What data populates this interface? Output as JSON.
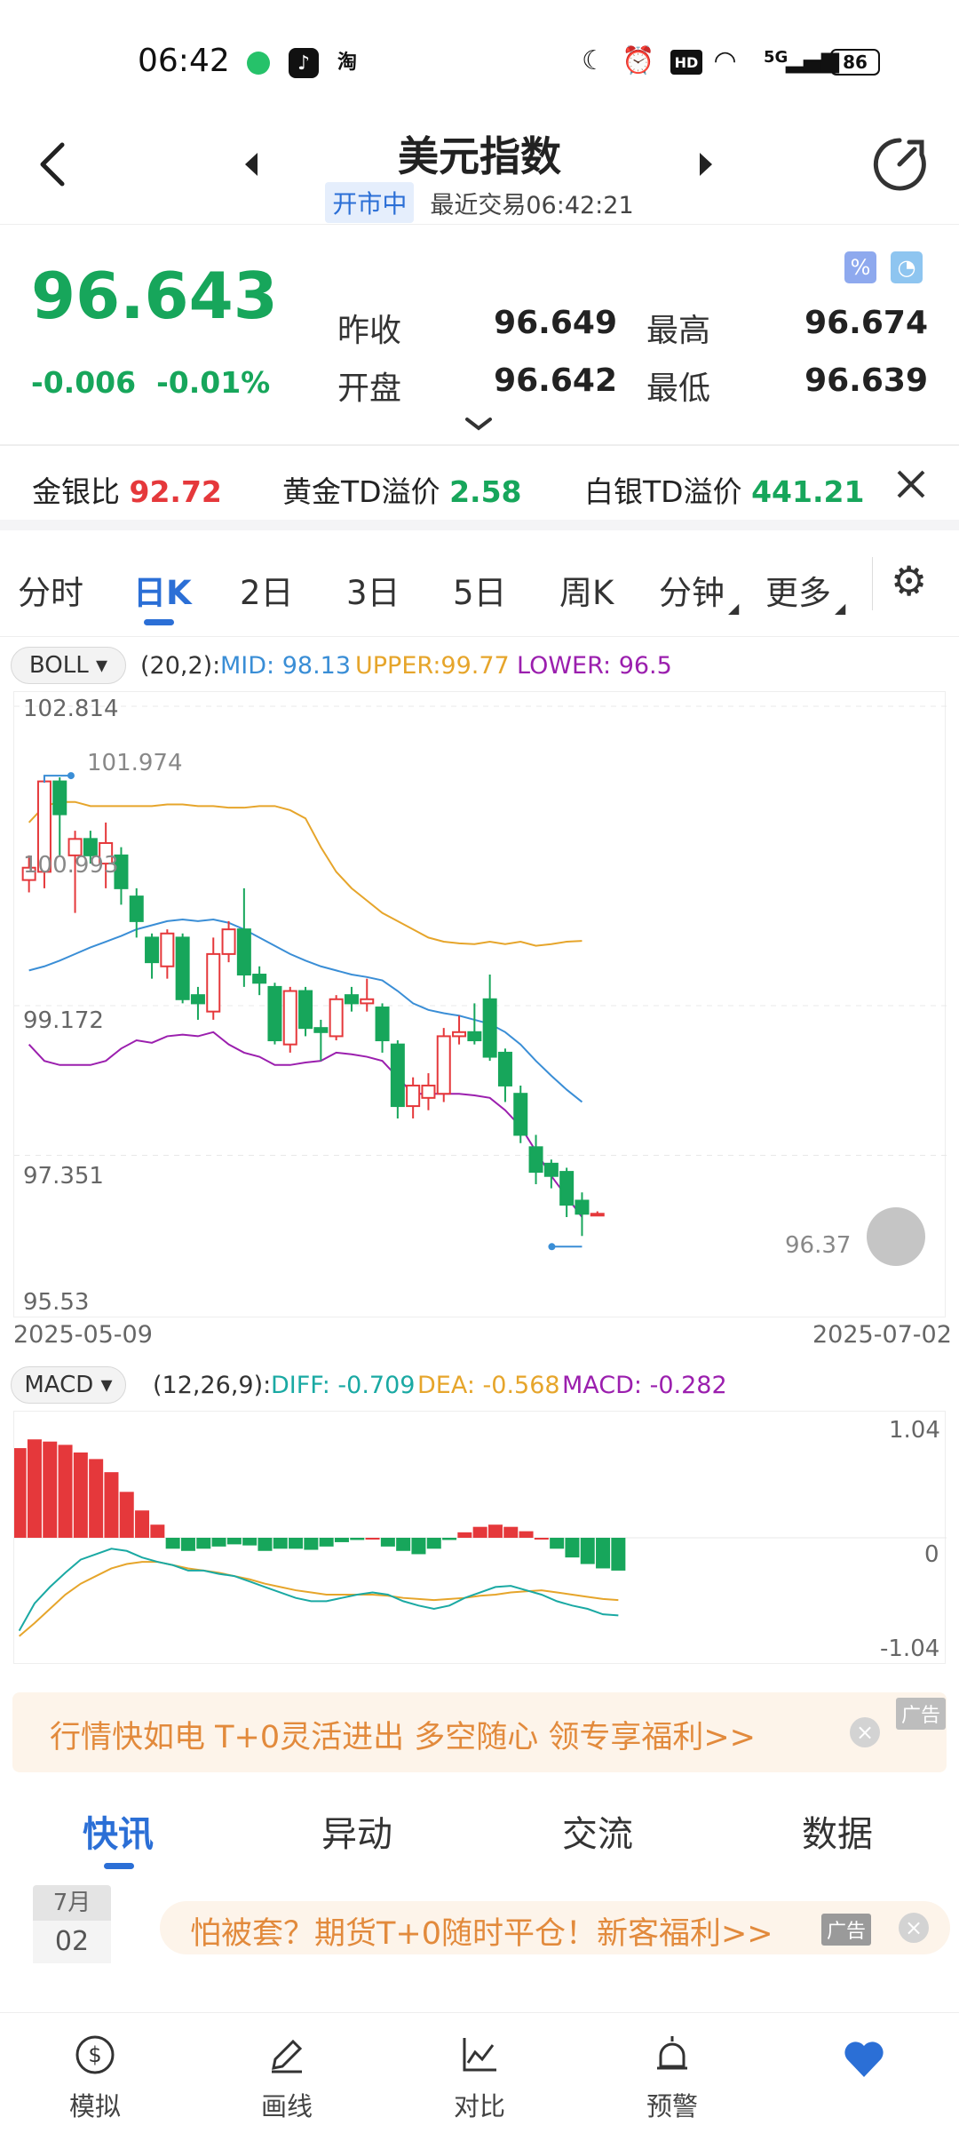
{
  "status_bar": {
    "time": "06:42",
    "battery": "86",
    "network": "5G",
    "hd": "HD"
  },
  "header": {
    "title": "美元指数",
    "market_status": "开市中",
    "last_trade": "最近交易06:42:21"
  },
  "quote": {
    "price": "96.643",
    "change": "-0.006",
    "change_pct": "-0.01%",
    "prev_close_label": "昨收",
    "prev_close": "96.649",
    "high_label": "最高",
    "high": "96.674",
    "open_label": "开盘",
    "open": "96.642",
    "low_label": "最低",
    "low": "96.639"
  },
  "ticker": [
    {
      "label": "金银比",
      "value": "92.72",
      "color": "#e5383b"
    },
    {
      "label": "黄金TD溢价",
      "value": "2.58",
      "color": "#17a65b"
    },
    {
      "label": "白银TD溢价",
      "value": "441.21",
      "color": "#17a65b"
    }
  ],
  "period_tabs": [
    "分时",
    "日K",
    "2日",
    "3日",
    "5日",
    "周K",
    "分钟",
    "更多"
  ],
  "active_tab": "日K",
  "boll": {
    "name": "BOLL",
    "params": "(20,2):",
    "mid": "MID: 98.13",
    "upper": "UPPER:99.77",
    "lower": "LOWER: 96.5"
  },
  "price_axis": {
    "top": "102.814",
    "mid1": "99.172",
    "mid2": "97.351",
    "bottom": "95.53",
    "max_label": "101.974",
    "left_label": "100.993",
    "min_label": "96.37"
  },
  "date_range": {
    "start": "2025-05-09",
    "end": "2025-07-02"
  },
  "macd": {
    "name": "MACD",
    "params": "(12,26,9):",
    "diff": "DIFF: -0.709",
    "dea": "DEA: -0.568",
    "macd": "MACD: -0.282",
    "axis_top": "1.04",
    "axis_mid": "0",
    "axis_bottom": "-1.04"
  },
  "colors": {
    "up": "#e5383b",
    "down": "#17a65b",
    "mid": "#3a8ed6",
    "upper": "#e6a52b",
    "lower": "#9b1fae",
    "accent": "#2b6fd6"
  },
  "chart_data": [
    {
      "type": "candlestick",
      "ylim": [
        95.53,
        102.814
      ],
      "candles": [
        [
          100.7,
          100.85,
          101.0,
          100.55
        ],
        [
          100.8,
          101.9,
          101.97,
          100.6
        ],
        [
          101.9,
          101.5,
          101.95,
          101.0
        ],
        [
          101.0,
          101.2,
          101.3,
          100.3
        ],
        [
          101.2,
          101.0,
          101.3,
          100.9
        ],
        [
          100.9,
          101.15,
          101.4,
          100.6
        ],
        [
          101.0,
          100.6,
          101.1,
          100.4
        ],
        [
          100.5,
          100.2,
          100.6,
          100.0
        ],
        [
          100.0,
          99.7,
          100.05,
          99.5
        ],
        [
          99.65,
          100.05,
          100.1,
          99.5
        ],
        [
          100.0,
          99.25,
          100.05,
          99.2
        ],
        [
          99.3,
          99.2,
          99.4,
          99.0
        ],
        [
          99.1,
          99.8,
          100.0,
          99.0
        ],
        [
          99.8,
          100.1,
          100.2,
          99.7
        ],
        [
          100.1,
          99.55,
          100.6,
          99.4
        ],
        [
          99.55,
          99.45,
          99.65,
          99.3
        ],
        [
          99.4,
          98.75,
          99.45,
          98.7
        ],
        [
          98.7,
          99.35,
          99.4,
          98.6
        ],
        [
          99.35,
          98.9,
          99.4,
          98.8
        ],
        [
          98.9,
          98.85,
          99.0,
          98.5
        ],
        [
          98.8,
          99.25,
          99.3,
          98.75
        ],
        [
          99.3,
          99.2,
          99.4,
          99.1
        ],
        [
          99.2,
          99.25,
          99.5,
          99.1
        ],
        [
          99.15,
          98.75,
          99.2,
          98.6
        ],
        [
          98.7,
          97.95,
          98.75,
          97.8
        ],
        [
          97.95,
          98.2,
          98.3,
          97.8
        ],
        [
          98.05,
          98.2,
          98.35,
          97.9
        ],
        [
          98.1,
          98.8,
          98.9,
          98.0
        ],
        [
          98.8,
          98.85,
          99.05,
          98.7
        ],
        [
          98.85,
          98.75,
          99.2,
          98.7
        ],
        [
          99.25,
          98.55,
          99.55,
          98.5
        ],
        [
          98.6,
          98.2,
          98.65,
          98.0
        ],
        [
          98.1,
          97.6,
          98.2,
          97.5
        ],
        [
          97.45,
          97.15,
          97.6,
          97.0
        ],
        [
          97.25,
          97.1,
          97.3,
          96.95
        ],
        [
          97.15,
          96.75,
          97.2,
          96.6
        ],
        [
          96.8,
          96.64,
          96.9,
          96.37
        ],
        [
          96.64,
          96.64,
          96.67,
          96.64
        ]
      ],
      "mid": [
        99.6,
        99.65,
        99.72,
        99.8,
        99.88,
        99.95,
        100.02,
        100.1,
        100.15,
        100.2,
        100.22,
        100.2,
        100.22,
        100.18,
        100.1,
        100.0,
        99.9,
        99.8,
        99.72,
        99.65,
        99.6,
        99.55,
        99.52,
        99.48,
        99.35,
        99.2,
        99.12,
        99.08,
        99.05,
        99.0,
        98.95,
        98.85,
        98.7,
        98.5,
        98.32,
        98.15,
        98.0
      ],
      "upper": [
        101.4,
        101.6,
        101.65,
        101.65,
        101.6,
        101.6,
        101.6,
        101.6,
        101.6,
        101.62,
        101.62,
        101.6,
        101.6,
        101.58,
        101.58,
        101.6,
        101.6,
        101.55,
        101.45,
        101.1,
        100.8,
        100.6,
        100.45,
        100.3,
        100.2,
        100.1,
        100.0,
        99.95,
        99.93,
        99.92,
        99.95,
        99.92,
        99.95,
        99.9,
        99.92,
        99.95,
        99.96
      ],
      "lower": [
        98.7,
        98.5,
        98.45,
        98.45,
        98.45,
        98.5,
        98.65,
        98.75,
        98.72,
        98.8,
        98.82,
        98.8,
        98.85,
        98.7,
        98.6,
        98.55,
        98.45,
        98.45,
        98.48,
        98.5,
        98.6,
        98.58,
        98.55,
        98.5,
        98.3,
        98.1,
        98.1,
        98.1,
        98.1,
        98.08,
        98.05,
        97.9,
        97.7,
        97.4,
        97.1,
        96.85,
        96.6
      ]
    },
    {
      "type": "bar",
      "ylim": [
        -1.04,
        1.04
      ],
      "macd": [
        0.82,
        0.9,
        0.88,
        0.85,
        0.78,
        0.72,
        0.6,
        0.42,
        0.25,
        0.12,
        -0.1,
        -0.12,
        -0.1,
        -0.08,
        -0.06,
        -0.07,
        -0.12,
        -0.1,
        -0.1,
        -0.11,
        -0.08,
        -0.04,
        -0.02,
        0.0,
        -0.08,
        -0.12,
        -0.15,
        -0.1,
        -0.02,
        0.05,
        0.1,
        0.12,
        0.1,
        0.06,
        0.0,
        -0.1,
        -0.18,
        -0.24,
        -0.28,
        -0.3
      ],
      "diff": [
        -0.85,
        -0.6,
        -0.45,
        -0.32,
        -0.2,
        -0.15,
        -0.1,
        -0.12,
        -0.18,
        -0.22,
        -0.25,
        -0.3,
        -0.3,
        -0.33,
        -0.35,
        -0.4,
        -0.45,
        -0.5,
        -0.55,
        -0.58,
        -0.58,
        -0.55,
        -0.52,
        -0.5,
        -0.52,
        -0.58,
        -0.62,
        -0.65,
        -0.62,
        -0.55,
        -0.5,
        -0.45,
        -0.44,
        -0.48,
        -0.52,
        -0.58,
        -0.62,
        -0.65,
        -0.7,
        -0.71
      ],
      "dea": [
        -0.9,
        -0.78,
        -0.65,
        -0.52,
        -0.42,
        -0.35,
        -0.28,
        -0.24,
        -0.22,
        -0.22,
        -0.25,
        -0.28,
        -0.3,
        -0.32,
        -0.35,
        -0.38,
        -0.42,
        -0.45,
        -0.48,
        -0.5,
        -0.52,
        -0.52,
        -0.52,
        -0.52,
        -0.53,
        -0.55,
        -0.56,
        -0.57,
        -0.56,
        -0.55,
        -0.53,
        -0.52,
        -0.5,
        -0.49,
        -0.48,
        -0.5,
        -0.52,
        -0.54,
        -0.56,
        -0.57
      ]
    }
  ],
  "ad_banner": {
    "text": "行情快如电 T+0灵活进出 多空随心 领专享福利>>",
    "tag": "广告"
  },
  "news_tabs": [
    "快讯",
    "异动",
    "交流",
    "数据"
  ],
  "news_date": {
    "month": "7月",
    "day": "02"
  },
  "ad_banner2": {
    "text": "怕被套？期货T+0随时平仓！新客福利>>",
    "tag": "广告"
  },
  "bottom_nav": [
    "模拟",
    "画线",
    "对比",
    "预警"
  ]
}
